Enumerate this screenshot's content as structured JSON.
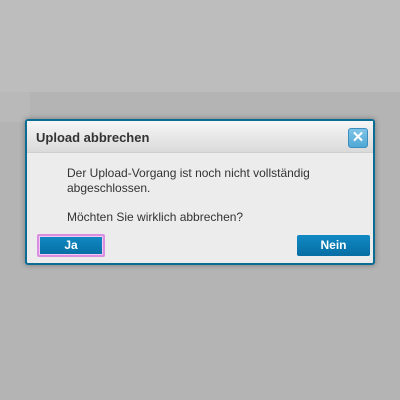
{
  "dialog": {
    "title": "Upload abbrechen",
    "close_symbol": "✕",
    "message_line1": "Der Upload-Vorgang ist noch nicht vollständig abgeschlossen.",
    "message_line2": "Möchten Sie wirklich abbrechen?",
    "yes_label": "Ja",
    "no_label": "Nein"
  },
  "colors": {
    "backdrop": "#b4b4b4",
    "dialog_border": "#0b6d94",
    "button": "#0a7ab5",
    "focus_ring": "#d98fe0"
  },
  "icons": {
    "close": "close-icon"
  }
}
